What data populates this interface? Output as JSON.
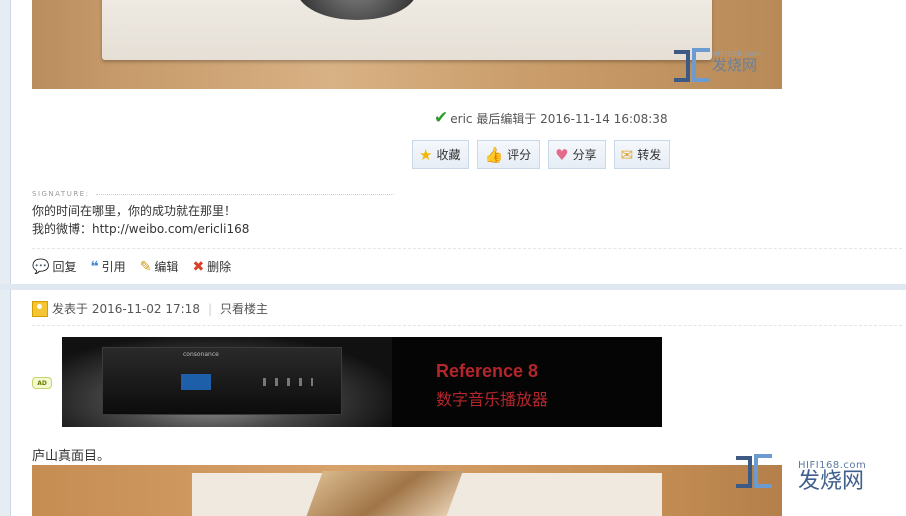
{
  "post_meta": {
    "edited_note": "eric 最后编辑于 2016-11-14 16:08:38"
  },
  "action_buttons": [
    {
      "label": "收藏",
      "icon": "star-icon"
    },
    {
      "label": "评分",
      "icon": "thumbs-up-icon"
    },
    {
      "label": "分享",
      "icon": "heart-icon"
    },
    {
      "label": "转发",
      "icon": "mail-icon"
    }
  ],
  "signature": {
    "label": "SIGNATURE:",
    "line1": "你的时间在哪里，你的成功就在那里！",
    "line2": "我的微博：http://weibo.com/ericli168"
  },
  "post_footer": [
    {
      "label": "回复",
      "icon": "reply-icon"
    },
    {
      "label": "引用",
      "icon": "quote-icon"
    },
    {
      "label": "编辑",
      "icon": "edit-icon"
    },
    {
      "label": "删除",
      "icon": "delete-icon"
    }
  ],
  "next_post": {
    "posted_at": "发表于 2016-11-02 17:18",
    "only_author": "只看楼主",
    "caption": "庐山真面目。"
  },
  "ad": {
    "badge": "AD",
    "title": "Reference 8",
    "subtitle": "数字音乐播放器",
    "brand": "consonance"
  },
  "watermark": {
    "site": "HIFI168.com",
    "name": "发烧网"
  }
}
